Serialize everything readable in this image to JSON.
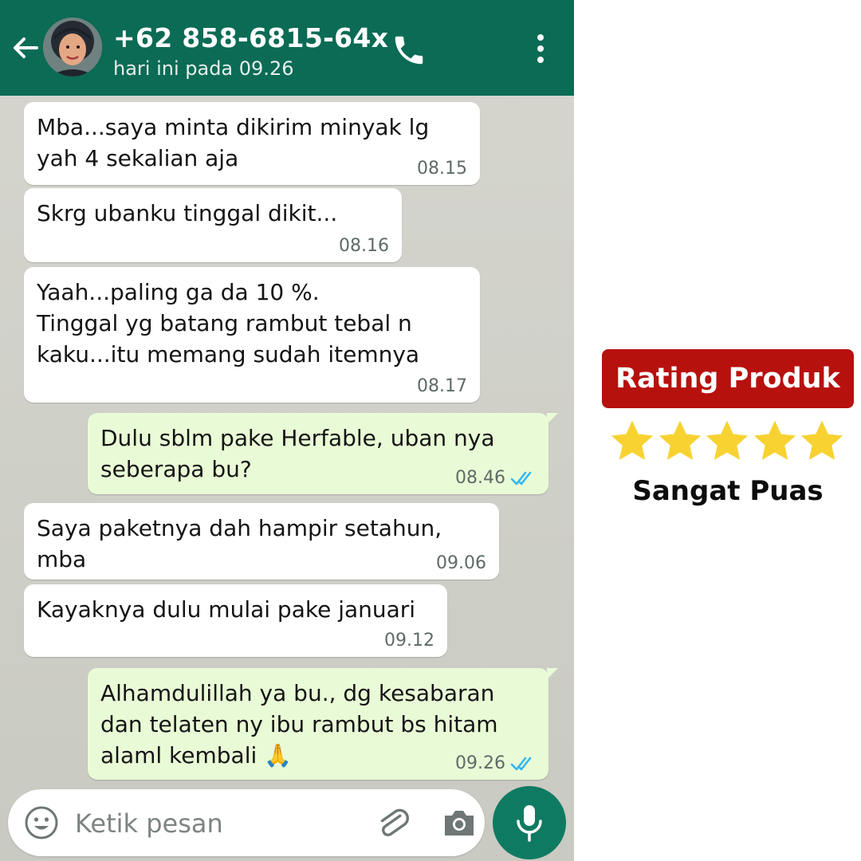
{
  "header": {
    "contact_name": "+62 858-6815-64x",
    "status": "hari ini pada 09.26"
  },
  "messages": [
    {
      "direction": "in",
      "text": "Mba...saya minta dikirim minyak lg\nyah 4 sekalian aja",
      "time": "08.15"
    },
    {
      "direction": "in",
      "text": "Skrg ubanku tinggal dikit...",
      "time": "08.16"
    },
    {
      "direction": "in",
      "text": "Yaah...paling ga da 10 %.\nTinggal yg batang rambut tebal n\nkaku...itu memang sudah itemnya",
      "time": "08.17"
    },
    {
      "direction": "out",
      "text": "Dulu sblm pake Herfable, uban nya\nseberapa bu?",
      "time": "08.46",
      "ticks": "read-ticks-icon"
    },
    {
      "direction": "in",
      "text": "Saya paketnya dah hampir setahun,\nmba",
      "time": "09.06"
    },
    {
      "direction": "in",
      "text": "Kayaknya dulu mulai pake januari",
      "time": "09.12"
    },
    {
      "direction": "out",
      "text": "Alhamdulillah ya bu., dg kesabaran\ndan telaten ny ibu rambut bs hitam\nalaml kembali 🙏",
      "time": "09.26",
      "ticks": "read-ticks-icon"
    }
  ],
  "composer": {
    "placeholder": "Ketik pesan"
  },
  "rating": {
    "title": "Rating Produk",
    "stars": 5,
    "max_stars": 5,
    "label": "Sangat Puas"
  },
  "colors": {
    "header": "#0b6b55",
    "outgoing_bubble": "#e9fbd6",
    "incoming_bubble": "#ffffff",
    "read_ticks": "#34b7f1",
    "badge": "#b7110e",
    "star": "#f7d231"
  }
}
